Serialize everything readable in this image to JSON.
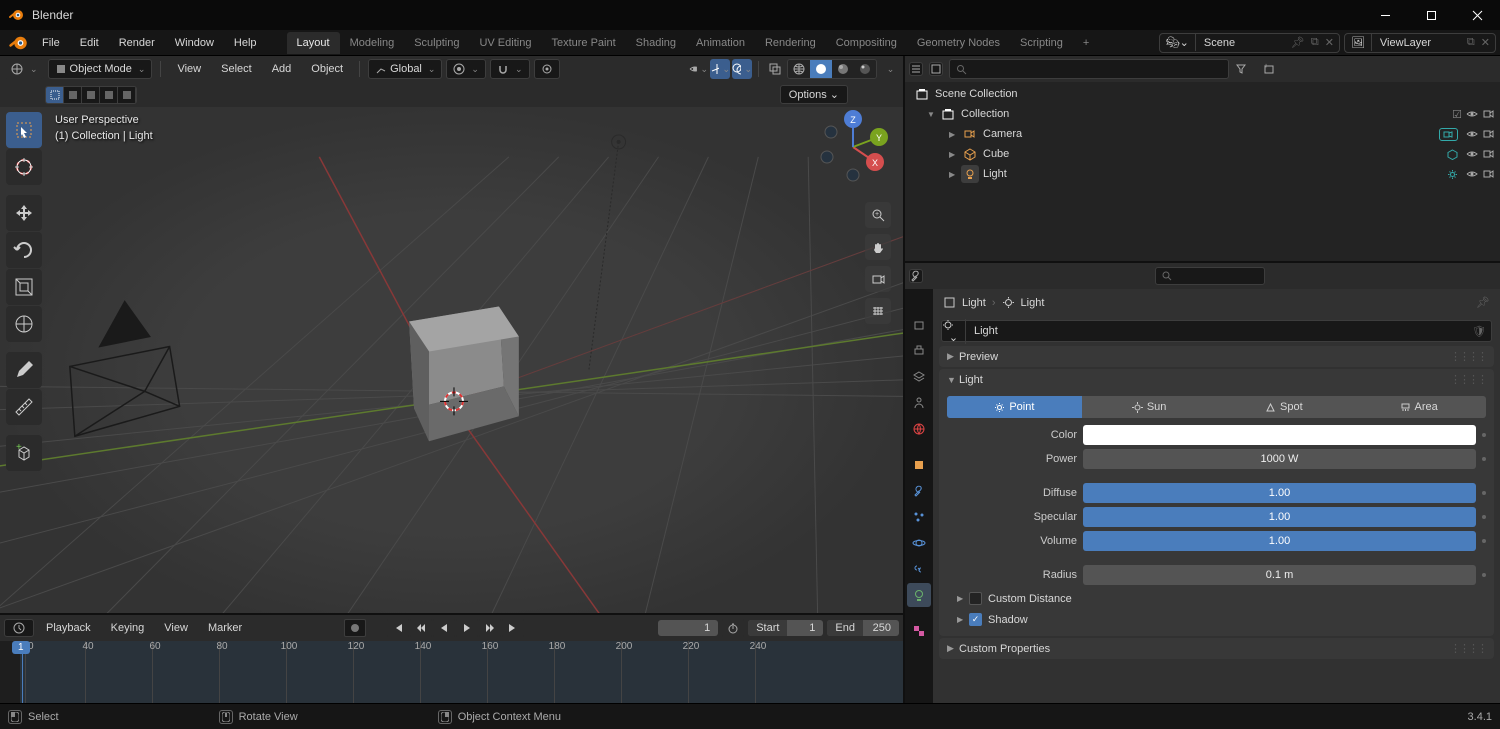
{
  "window": {
    "title": "Blender",
    "version": "3.4.1"
  },
  "menu": {
    "file": "File",
    "edit": "Edit",
    "render": "Render",
    "window": "Window",
    "help": "Help"
  },
  "workspaces": [
    "Layout",
    "Modeling",
    "Sculpting",
    "UV Editing",
    "Texture Paint",
    "Shading",
    "Animation",
    "Rendering",
    "Compositing",
    "Geometry Nodes",
    "Scripting"
  ],
  "workspace_active": "Layout",
  "scene_selector": {
    "scene": "Scene",
    "viewlayer": "ViewLayer"
  },
  "viewport_header": {
    "mode": "Object Mode",
    "menus": {
      "view": "View",
      "select": "Select",
      "add": "Add",
      "object": "Object"
    },
    "orientation": "Global",
    "options": "Options"
  },
  "viewport_info": {
    "line1": "User Perspective",
    "line2": "(1) Collection | Light"
  },
  "gizmo_labels": {
    "x": "X",
    "y": "Y",
    "z": "Z"
  },
  "outliner": {
    "root": "Scene Collection",
    "collection": "Collection",
    "items": [
      {
        "name": "Camera",
        "type": "camera"
      },
      {
        "name": "Cube",
        "type": "mesh"
      },
      {
        "name": "Light",
        "type": "light",
        "selected": true
      }
    ]
  },
  "timeline": {
    "menus": {
      "playback": "Playback",
      "keying": "Keying",
      "view": "View",
      "marker": "Marker"
    },
    "current": "1",
    "start_label": "Start",
    "start": "1",
    "end_label": "End",
    "end": "250",
    "ticks": [
      "20",
      "40",
      "60",
      "80",
      "100",
      "120",
      "140",
      "160",
      "180",
      "200",
      "220",
      "240"
    ],
    "playhead": "1"
  },
  "properties": {
    "breadcrumb": {
      "a": "Light",
      "b": "Light"
    },
    "datablock": "Light",
    "panels": {
      "preview": "Preview",
      "light": "Light",
      "custom_distance": "Custom Distance",
      "shadow": "Shadow",
      "custom_properties": "Custom Properties"
    },
    "light": {
      "types": {
        "point": "Point",
        "sun": "Sun",
        "spot": "Spot",
        "area": "Area"
      },
      "active_type": "Point",
      "color_label": "Color",
      "power_label": "Power",
      "power": "1000 W",
      "diffuse_label": "Diffuse",
      "diffuse": "1.00",
      "specular_label": "Specular",
      "specular": "1.00",
      "volume_label": "Volume",
      "volume": "1.00",
      "radius_label": "Radius",
      "radius": "0.1 m",
      "shadow_checked": true
    }
  },
  "statusbar": {
    "select": "Select",
    "rotate": "Rotate View",
    "context": "Object Context Menu"
  }
}
